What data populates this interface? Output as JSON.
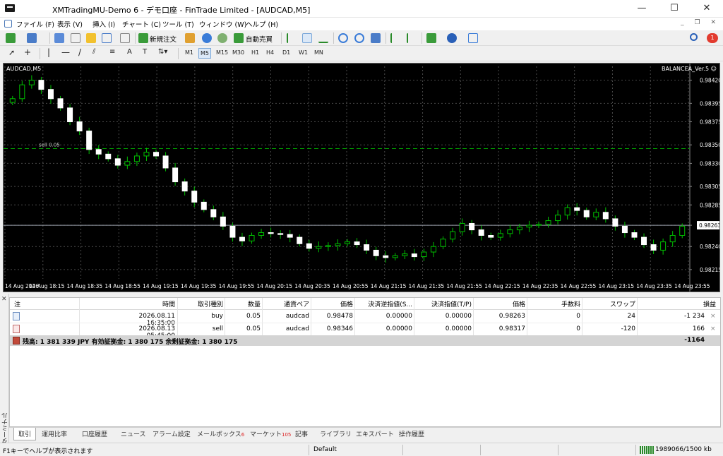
{
  "window": {
    "title": "XMTradingMU-Demo 6 - デモ口座 - FinTrade Limited - [AUDCAD,M5]",
    "minimize": "—",
    "maximize": "☐",
    "close": "✕"
  },
  "menu": {
    "items": [
      "ファイル (F)",
      "表示 (V)",
      "挿入 (I)",
      "チャート (C)",
      "ツール (T)",
      "ウィンドウ (W)",
      "ヘルプ (H)"
    ],
    "search_icon": "search-icon",
    "notifications_count": "1"
  },
  "toolbar": {
    "new_order_label": "新規注文",
    "autotrade_label": "自動売買"
  },
  "timeframes": [
    "M1",
    "M5",
    "M15",
    "M30",
    "H1",
    "H4",
    "D1",
    "W1",
    "MN"
  ],
  "active_timeframe": "M5",
  "chart": {
    "symbol_label": "AUDCAD,M5",
    "ea_label": "BALANCEA_Ver.5 ☺",
    "sell_line_label": "sell 0.05",
    "current_price_label": "0.98263",
    "colors": {
      "bg": "#000000",
      "bull": "#ffffff",
      "wick": "#00c000",
      "grid": "#4a4a4a",
      "sell_line": "#00a000"
    }
  },
  "chart_data": {
    "type": "candlestick",
    "title": "AUDCAD,M5",
    "y_ticks": [
      "0.98420",
      "0.98395",
      "0.98375",
      "0.98350",
      "0.98330",
      "0.98305",
      "0.98285",
      "0.98263",
      "0.98240",
      "0.98215"
    ],
    "x_ticks": [
      "14 Aug 2026",
      "14 Aug 18:15",
      "14 Aug 18:35",
      "14 Aug 18:55",
      "14 Aug 19:15",
      "14 Aug 19:35",
      "14 Aug 19:55",
      "14 Aug 20:15",
      "14 Aug 20:35",
      "14 Aug 20:55",
      "14 Aug 21:15",
      "14 Aug 21:35",
      "14 Aug 21:55",
      "14 Aug 22:15",
      "14 Aug 22:35",
      "14 Aug 22:55",
      "14 Aug 23:15",
      "14 Aug 23:35",
      "14 Aug 23:55"
    ],
    "ylim": [
      0.98205,
      0.98435
    ],
    "sell_level": 0.98346,
    "current_price": 0.98263,
    "close_series": [
      0.984,
      0.98415,
      0.9842,
      0.9841,
      0.984,
      0.9839,
      0.98375,
      0.98365,
      0.98345,
      0.9834,
      0.98335,
      0.98328,
      0.98332,
      0.98338,
      0.98342,
      0.98338,
      0.98325,
      0.9831,
      0.983,
      0.98288,
      0.9828,
      0.98272,
      0.98262,
      0.9825,
      0.98246,
      0.98252,
      0.98255,
      0.98254,
      0.98253,
      0.9825,
      0.98243,
      0.98238,
      0.9824,
      0.98241,
      0.98243,
      0.98245,
      0.98242,
      0.98236,
      0.9823,
      0.98228,
      0.9823,
      0.98232,
      0.98229,
      0.98234,
      0.9824,
      0.98248,
      0.98256,
      0.98265,
      0.98258,
      0.98252,
      0.9825,
      0.98254,
      0.98258,
      0.98261,
      0.98263,
      0.98264,
      0.98268,
      0.98274,
      0.98282,
      0.98279,
      0.98272,
      0.98277,
      0.9827,
      0.98262,
      0.98255,
      0.9825,
      0.98242,
      0.98236,
      0.98245,
      0.98252,
      0.98262
    ]
  },
  "terminal": {
    "panel_label": "ターミナル",
    "columns": [
      "注",
      "時間",
      "取引種別",
      "数量",
      "通貨ペア",
      "価格",
      "決済逆指値(S...",
      "決済指値(T/P)",
      "価格",
      "手数料",
      "スワップ",
      "損益"
    ],
    "rows": [
      {
        "icon": "buy-order-icon",
        "time": "2026.08.11 16:35:00",
        "type": "buy",
        "volume": "0.05",
        "symbol": "audcad",
        "price": "0.98478",
        "sl": "0.00000",
        "tp": "0.00000",
        "cur_price": "0.98263",
        "commission": "0",
        "swap": "24",
        "profit": "-1 234"
      },
      {
        "icon": "sell-order-icon",
        "time": "2026.08.13 05:45:00",
        "type": "sell",
        "volume": "0.05",
        "symbol": "audcad",
        "price": "0.98346",
        "sl": "0.00000",
        "tp": "0.00000",
        "cur_price": "0.98317",
        "commission": "0",
        "swap": "-120",
        "profit": "166"
      }
    ],
    "balance_text": "残高: 1 381 339 JPY  有効証拠金: 1 380 175  余剰証拠金: 1 380 175",
    "total_profit": "-1164",
    "row_close": "×"
  },
  "tabs": [
    {
      "label": "取引",
      "badge": ""
    },
    {
      "label": "運用比率",
      "badge": ""
    },
    {
      "label": "口座履歴",
      "badge": ""
    },
    {
      "label": "ニュース",
      "badge": ""
    },
    {
      "label": "アラーム設定",
      "badge": ""
    },
    {
      "label": "メールボックス",
      "badge": "6"
    },
    {
      "label": "マーケット",
      "badge": "105"
    },
    {
      "label": "記事",
      "badge": ""
    },
    {
      "label": "ライブラリ",
      "badge": ""
    },
    {
      "label": "エキスパート",
      "badge": ""
    },
    {
      "label": "操作履歴",
      "badge": ""
    }
  ],
  "status": {
    "help": "F1キーでヘルプが表示されます",
    "profile": "Default",
    "traffic": "1989066/1500 kb"
  }
}
